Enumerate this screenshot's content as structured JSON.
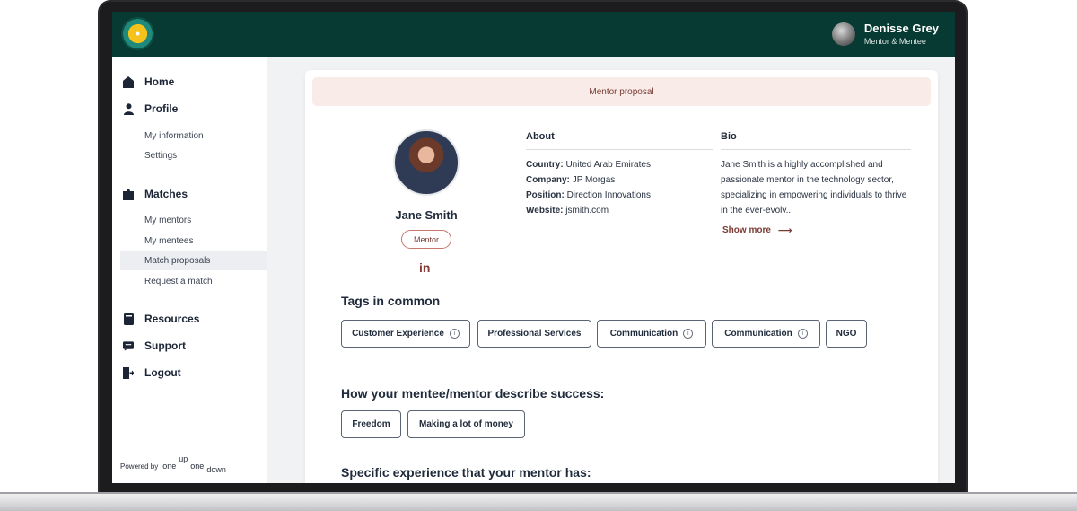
{
  "header": {
    "user_name": "Denisse Grey",
    "user_role": "Mentor & Mentee"
  },
  "sidebar": {
    "home": "Home",
    "profile": "Profile",
    "profile_items": [
      "My information",
      "Settings"
    ],
    "matches": "Matches",
    "matches_items": [
      "My mentors",
      "My mentees",
      "Match proposals",
      "Request a match"
    ],
    "active_item": "Match proposals",
    "resources": "Resources",
    "support": "Support",
    "logout": "Logout",
    "powered_by": "Powered by",
    "brand_one_a": "one",
    "brand_up": "up",
    "brand_one_b": "one",
    "brand_down": "down"
  },
  "main": {
    "banner": "Mentor proposal",
    "profile": {
      "name": "Jane Smith",
      "role": "Mentor",
      "linkedin": "in"
    },
    "about": {
      "title": "About",
      "country_label": "Country:",
      "country": "United Arab Emirates",
      "company_label": "Company:",
      "company": "JP Morgas",
      "position_label": "Position:",
      "position": "Direction Innovations",
      "website_label": "Website:",
      "website": "jsmith.com"
    },
    "bio": {
      "title": "Bio",
      "text": "Jane Smith is a highly accomplished and passionate mentor in the technology sector, specializing in empowering individuals to thrive in the ever-evolv...",
      "show_more": "Show more"
    },
    "tags_title": "Tags in common",
    "tags": [
      "Customer Experience",
      "Professional Services",
      "Communication",
      "Communication",
      "NGO"
    ],
    "success_title": "How your mentee/mentor describe success:",
    "success_tags": [
      "Freedom",
      "Making a lot of money"
    ],
    "experience_title": "Specific experience that your mentor has:"
  },
  "colors": {
    "topbar": "#073a32",
    "accent": "#7a3b33",
    "banner": "#f8ebe8"
  },
  "icons": [
    "logo-icon",
    "home-icon",
    "profile-icon",
    "matches-icon",
    "resources-icon",
    "support-icon",
    "logout-icon",
    "linkedin-icon",
    "info-icon",
    "arrow-right-icon"
  ]
}
